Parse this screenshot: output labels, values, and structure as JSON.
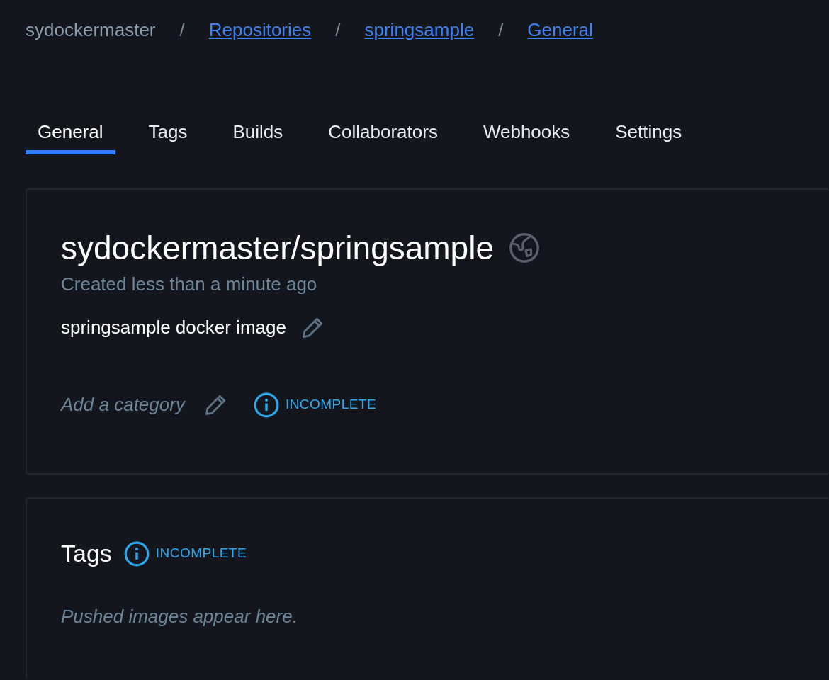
{
  "breadcrumb": [
    {
      "label": "sydockermaster",
      "kind": "text"
    },
    {
      "label": "/",
      "kind": "separator"
    },
    {
      "label": "Repositories",
      "kind": "link"
    },
    {
      "label": "/",
      "kind": "separator"
    },
    {
      "label": "springsample",
      "kind": "link"
    },
    {
      "label": "/",
      "kind": "separator"
    },
    {
      "label": "General",
      "kind": "link"
    }
  ],
  "tabs": [
    {
      "label": "General",
      "selected": true
    },
    {
      "label": "Tags",
      "selected": false
    },
    {
      "label": "Builds",
      "selected": false
    },
    {
      "label": "Collaborators",
      "selected": false
    },
    {
      "label": "Webhooks",
      "selected": false
    },
    {
      "label": "Settings",
      "selected": false
    }
  ],
  "repository": {
    "title": "sydockermaster/springsample",
    "created": "Created less than a minute ago",
    "description": "springsample docker image",
    "category_prompt": "Add a category",
    "category_status": "INCOMPLETE"
  },
  "tags_section": {
    "title": "Tags",
    "status": "INCOMPLETE",
    "empty_message": "Pushed images appear here."
  }
}
